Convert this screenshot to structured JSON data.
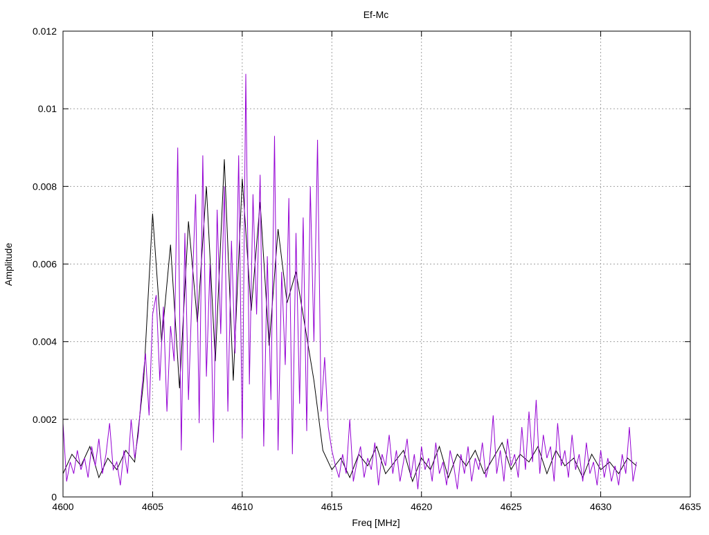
{
  "chart_data": {
    "type": "line",
    "title": "Ef-Mc",
    "xlabel": "Freq [MHz]",
    "ylabel": "Amplitude",
    "xlim": [
      4600,
      4635
    ],
    "ylim": [
      0,
      0.012
    ],
    "xticks": [
      4600,
      4605,
      4610,
      4615,
      4620,
      4625,
      4630,
      4635
    ],
    "xtick_labels": [
      "4600",
      "4605",
      "4610",
      "4615",
      "4620",
      "4625",
      "4630",
      "4635"
    ],
    "yticks": [
      0,
      0.002,
      0.004,
      0.006,
      0.008,
      0.01,
      0.012
    ],
    "ytick_labels": [
      "0",
      "0.002",
      "0.004",
      "0.006",
      "0.008",
      "0.01",
      "0.012"
    ],
    "grid": true,
    "series": [
      {
        "name": "black",
        "color": "#000000",
        "x_start": 4600,
        "x_step": 0.5,
        "values": [
          0.0006,
          0.0011,
          0.0008,
          0.0013,
          0.0005,
          0.001,
          0.0007,
          0.0012,
          0.0009,
          0.003,
          0.0073,
          0.004,
          0.0065,
          0.0028,
          0.0071,
          0.0045,
          0.008,
          0.0035,
          0.0087,
          0.003,
          0.0082,
          0.0048,
          0.0076,
          0.0039,
          0.0069,
          0.005,
          0.0058,
          0.0044,
          0.003,
          0.0012,
          0.0007,
          0.001,
          0.0005,
          0.0011,
          0.0008,
          0.0013,
          0.0006,
          0.0009,
          0.0012,
          0.0004,
          0.001,
          0.0007,
          0.0013,
          0.0005,
          0.0011,
          0.0008,
          0.0012,
          0.0006,
          0.001,
          0.0014,
          0.0007,
          0.0011,
          0.0009,
          0.0013,
          0.0006,
          0.0012,
          0.0008,
          0.001,
          0.0005,
          0.0011,
          0.0007,
          0.0009,
          0.0006,
          0.001,
          0.0008
        ]
      },
      {
        "name": "purple",
        "color": "#9400d3",
        "x_start": 4600,
        "x_step": 0.2,
        "values": [
          0.0019,
          0.0004,
          0.0009,
          0.0006,
          0.0012,
          0.0007,
          0.001,
          0.0005,
          0.0013,
          0.0008,
          0.0015,
          0.0006,
          0.0011,
          0.0019,
          0.0007,
          0.0009,
          0.0003,
          0.0012,
          0.0006,
          0.002,
          0.001,
          0.0016,
          0.0028,
          0.0037,
          0.0021,
          0.0047,
          0.0052,
          0.003,
          0.0049,
          0.0022,
          0.0044,
          0.0035,
          0.009,
          0.0012,
          0.0068,
          0.0025,
          0.0053,
          0.0078,
          0.0019,
          0.0088,
          0.0031,
          0.006,
          0.0014,
          0.0074,
          0.0042,
          0.008,
          0.0022,
          0.0066,
          0.0037,
          0.0088,
          0.0015,
          0.0109,
          0.0029,
          0.0078,
          0.0047,
          0.0083,
          0.0013,
          0.0062,
          0.0025,
          0.0093,
          0.0012,
          0.0058,
          0.0034,
          0.0077,
          0.0011,
          0.0068,
          0.0024,
          0.0072,
          0.0017,
          0.008,
          0.004,
          0.0092,
          0.0022,
          0.0036,
          0.0018,
          0.0012,
          0.0008,
          0.0005,
          0.0011,
          0.0006,
          0.002,
          0.0004,
          0.0009,
          0.0013,
          0.0005,
          0.001,
          0.0007,
          0.0014,
          0.0003,
          0.0011,
          0.0008,
          0.0016,
          0.0006,
          0.0012,
          0.0004,
          0.0009,
          0.0015,
          0.0005,
          0.0011,
          0.0002,
          0.0013,
          0.0007,
          0.001,
          0.0004,
          0.0014,
          0.0006,
          0.0009,
          0.0003,
          0.0012,
          0.0008,
          0.0002,
          0.0011,
          0.0006,
          0.0013,
          0.0004,
          0.001,
          0.0007,
          0.0014,
          0.0005,
          0.0009,
          0.0021,
          0.0006,
          0.0012,
          0.0004,
          0.0015,
          0.0008,
          0.0011,
          0.0005,
          0.0018,
          0.0007,
          0.0022,
          0.0009,
          0.0025,
          0.0006,
          0.0016,
          0.001,
          0.0013,
          0.0004,
          0.0019,
          0.0008,
          0.0012,
          0.0005,
          0.0016,
          0.0007,
          0.0011,
          0.0004,
          0.0014,
          0.0006,
          0.0009,
          0.0003,
          0.0012,
          0.0005,
          0.001,
          0.0004,
          0.0008,
          0.0003,
          0.0011,
          0.0006,
          0.0018,
          0.0004,
          0.0009
        ]
      }
    ]
  }
}
